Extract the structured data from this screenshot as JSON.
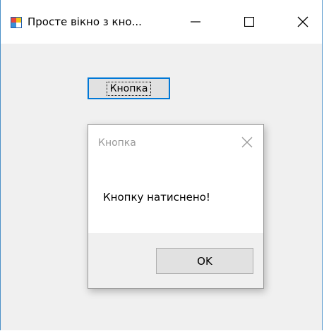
{
  "window": {
    "title": "Просте вікно з кно...",
    "accent_color": "#4a90c8"
  },
  "main": {
    "button_label": "Кнопка"
  },
  "dialog": {
    "title": "Кнопка",
    "message": "Кнопку натиснено!",
    "ok_label": "OK"
  },
  "icons": {
    "app": "app-icon",
    "minimize": "minimize-icon",
    "maximize": "maximize-icon",
    "close": "close-icon",
    "dialog_close": "close-icon"
  }
}
